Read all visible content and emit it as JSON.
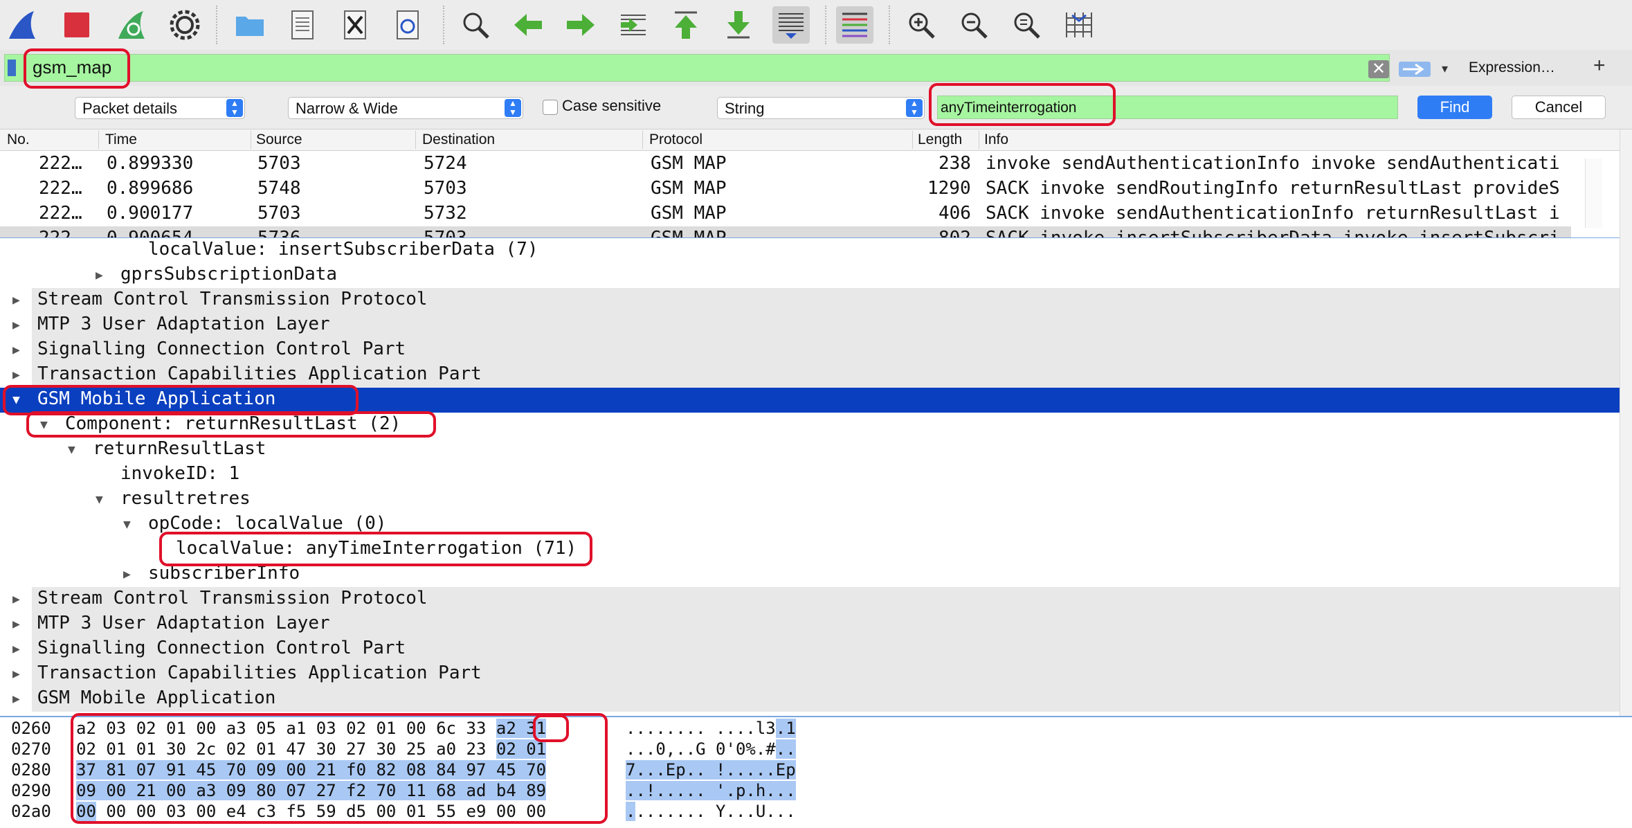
{
  "toolbar": {
    "icons": [
      "shark-fin-icon",
      "stop-icon",
      "restart-icon",
      "gear-icon",
      "folder-icon",
      "file-icon",
      "close-file-icon",
      "reload-icon",
      "search-icon",
      "arrow-left-icon",
      "arrow-right-icon",
      "go-to-packet-icon",
      "arrow-up-icon",
      "arrow-down-icon",
      "autoscroll-icon",
      "colorize-icon",
      "zoom-in-icon",
      "zoom-out-icon",
      "zoom-reset-icon",
      "resize-columns-icon"
    ]
  },
  "filter": {
    "value": "gsm_map",
    "clear_label": "✕",
    "expression_label": "Expression…",
    "add_label": "+"
  },
  "find": {
    "search_in": "Packet details",
    "char_width": "Narrow & Wide",
    "case_sensitive_label": "Case sensitive",
    "search_type": "String",
    "value": "anyTimeinterrogation",
    "find_label": "Find",
    "cancel_label": "Cancel"
  },
  "packet_list": {
    "columns": [
      "No.",
      "Time",
      "Source",
      "Destination",
      "Protocol",
      "Length",
      "Info"
    ],
    "rows": [
      {
        "no": "222…",
        "time": "0.899330",
        "source": "5703",
        "destination": "5724",
        "protocol": "GSM MAP",
        "length": "238",
        "info": "invoke sendAuthenticationInfo invoke sendAuthenticati"
      },
      {
        "no": "222…",
        "time": "0.899686",
        "source": "5748",
        "destination": "5703",
        "protocol": "GSM MAP",
        "length": "1290",
        "info": "SACK invoke sendRoutingInfo returnResultLast provideS"
      },
      {
        "no": "222…",
        "time": "0.900177",
        "source": "5703",
        "destination": "5732",
        "protocol": "GSM MAP",
        "length": "406",
        "info": "SACK invoke sendAuthenticationInfo returnResultLast i"
      },
      {
        "no": "222…",
        "time": "0.900654",
        "source": "5736",
        "destination": "5703",
        "protocol": "GSM MAP",
        "length": "802",
        "info": "SACK invoke insertSubscriberData invoke insertSubscri"
      }
    ]
  },
  "detail_tree": {
    "rows": [
      {
        "text": "localValue: insertSubscriberData (7)",
        "toggle": ""
      },
      {
        "text": "gprsSubscriptionData",
        "toggle": "▶"
      },
      {
        "text": "Stream Control Transmission Protocol",
        "toggle": "▶"
      },
      {
        "text": "MTP 3 User Adaptation Layer",
        "toggle": "▶"
      },
      {
        "text": "Signalling Connection Control Part",
        "toggle": "▶"
      },
      {
        "text": "Transaction Capabilities Application Part",
        "toggle": "▶"
      },
      {
        "text": "GSM Mobile Application",
        "toggle": "▼"
      },
      {
        "text": "Component: returnResultLast (2)",
        "toggle": "▼"
      },
      {
        "text": "returnResultLast",
        "toggle": "▼"
      },
      {
        "text": "invokeID: 1",
        "toggle": ""
      },
      {
        "text": "resultretres",
        "toggle": "▼"
      },
      {
        "text": "opCode: localValue (0)",
        "toggle": "▼"
      },
      {
        "text": "localValue: anyTimeInterrogation (71)",
        "toggle": ""
      },
      {
        "text": "subscriberInfo",
        "toggle": "▶"
      },
      {
        "text": "Stream Control Transmission Protocol",
        "toggle": "▶"
      },
      {
        "text": "MTP 3 User Adaptation Layer",
        "toggle": "▶"
      },
      {
        "text": "Signalling Connection Control Part",
        "toggle": "▶"
      },
      {
        "text": "Transaction Capabilities Application Part",
        "toggle": "▶"
      },
      {
        "text": "GSM Mobile Application",
        "toggle": "▶"
      }
    ]
  },
  "bytes": {
    "rows": [
      {
        "offset": "0260",
        "hex_a": "a2 03 02 01 00 a3 05 a1  03 02 01 00 6c 33 ",
        "hex_hl": "a2 31",
        "ascii_a": "........ ....l3",
        "ascii_hl": ".1"
      },
      {
        "offset": "0270",
        "hex_a": "02 01 01 30 2c 02 01 47  30 27 30 25 a0 23 ",
        "hex_hl": "02 01",
        "ascii_a": "...0,..G 0'0%.#",
        "ascii_hl": ".."
      },
      {
        "offset": "0280",
        "hex_a": "",
        "hex_hl": "37 81 07 91 45 70 09 00  21 f0 82 08 84 97 45 70",
        "ascii_a": "",
        "ascii_hl": "7...Ep.. !.....Ep"
      },
      {
        "offset": "0290",
        "hex_a": "",
        "hex_hl": "09 00 21 00 a3 09 80 07  27 f2 70 11 68 ad b4 89",
        "ascii_a": "",
        "ascii_hl": "..!..... '.p.h..."
      },
      {
        "offset": "02a0",
        "hex_a": "",
        "hex_hl": "00",
        "hex_b": " 00 00 03 00 e4 c3 f5  59 d5 00 01 55 e9 00 00",
        "ascii_a": "",
        "ascii_hl": ".",
        "ascii_b": "....... Y...U..."
      }
    ]
  }
}
